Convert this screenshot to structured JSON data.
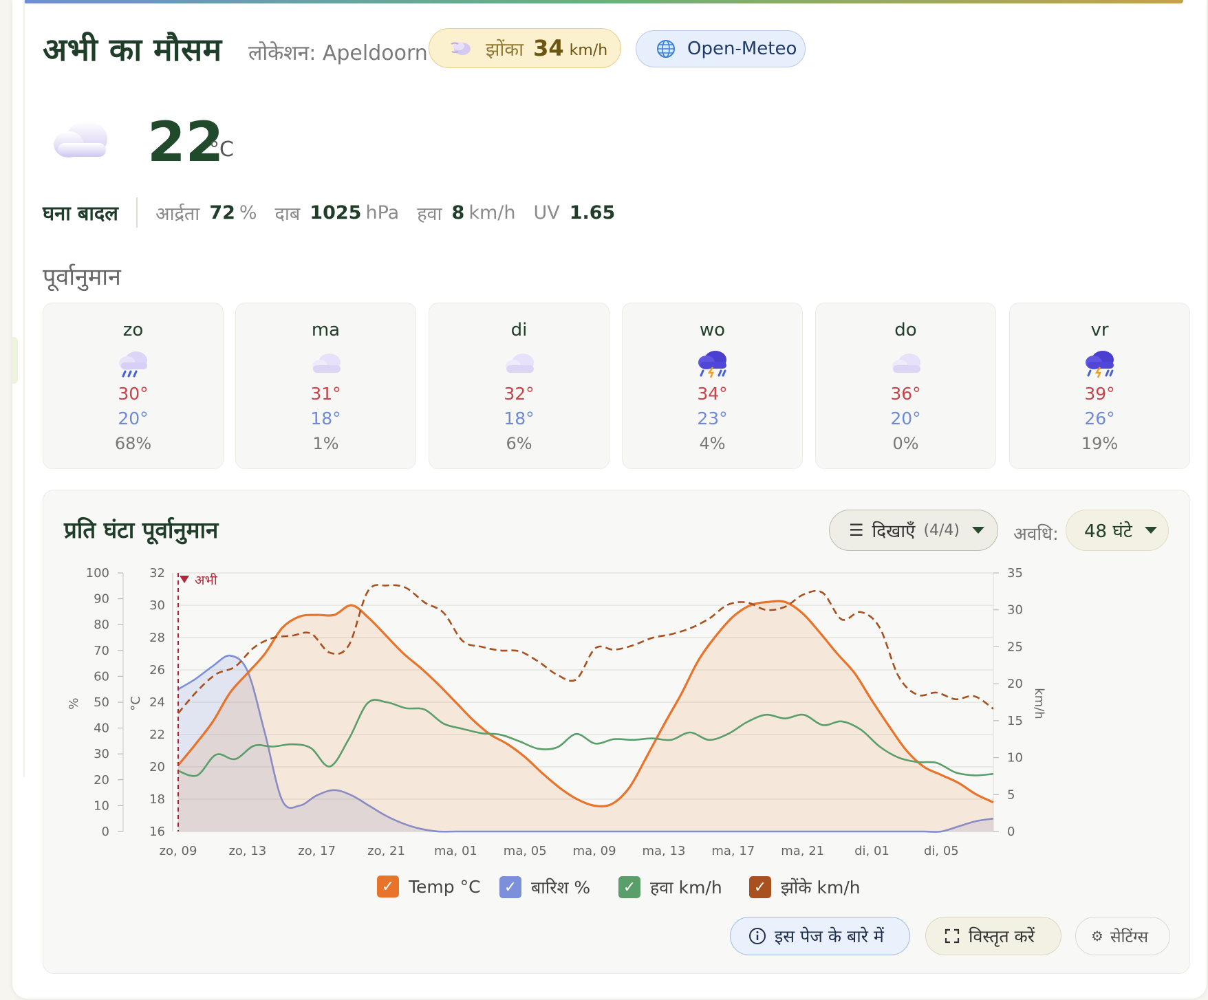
{
  "header": {
    "title": "अभी का मौसम",
    "location": "लोकेशन: Apeldoorn",
    "gust_label": "झोंका",
    "gust_value": "34",
    "gust_unit": "km/h",
    "source": "Open-Meteo"
  },
  "current": {
    "icon": "cloud-icon",
    "temperature": "22",
    "unit": "°C",
    "condition": "घना बादल",
    "humidity_label": "आर्द्रता",
    "humidity_value": "72",
    "humidity_unit": "%",
    "pressure_label": "दाब",
    "pressure_value": "1025",
    "pressure_unit": "hPa",
    "wind_label": "हवा",
    "wind_value": "8",
    "wind_unit": "km/h",
    "uv_label": "UV",
    "uv_value": "1.65"
  },
  "forecast": {
    "title": "पूर्वानुमान",
    "days": [
      {
        "day": "zo",
        "icon": "rain-cloud-icon",
        "high": "30°",
        "low": "20°",
        "precip": "68%"
      },
      {
        "day": "ma",
        "icon": "cloud-icon",
        "high": "31°",
        "low": "18°",
        "precip": "1%"
      },
      {
        "day": "di",
        "icon": "cloud-icon",
        "high": "32°",
        "low": "18°",
        "precip": "6%"
      },
      {
        "day": "wo",
        "icon": "thunderstorm-icon",
        "high": "34°",
        "low": "23°",
        "precip": "4%"
      },
      {
        "day": "do",
        "icon": "cloud-icon",
        "high": "36°",
        "low": "20°",
        "precip": "0%"
      },
      {
        "day": "vr",
        "icon": "thunderstorm-icon",
        "high": "39°",
        "low": "26°",
        "precip": "19%"
      }
    ]
  },
  "hourly": {
    "title": "प्रति घंटा पूर्वानुमान",
    "show_label": "दिखाएँ",
    "show_count": "(4/4)",
    "period_label": "अवधि:",
    "period_value": "48 घंटे",
    "now_label": "अभी",
    "legend": [
      {
        "label": "Temp °C",
        "color": "#e8732a"
      },
      {
        "label": "बारिश %",
        "color": "#7b8fdb"
      },
      {
        "label": "हवा km/h",
        "color": "#5a9e6a"
      },
      {
        "label": "झोंके km/h",
        "color": "#a8501e"
      }
    ],
    "about_button": "इस पेज के बारे में",
    "expand_button": "विस्तृत करें",
    "settings_button": "सेटिंग्स"
  },
  "chart_data": {
    "type": "line",
    "x_tick_labels": [
      "zo, 09",
      "zo, 13",
      "zo, 17",
      "zo, 21",
      "ma, 01",
      "ma, 05",
      "ma, 09",
      "ma, 13",
      "ma, 17",
      "ma, 21",
      "di, 01",
      "di, 05"
    ],
    "x_hours": [
      0,
      1,
      2,
      3,
      4,
      5,
      6,
      7,
      8,
      9,
      10,
      11,
      12,
      13,
      14,
      15,
      16,
      17,
      18,
      19,
      20,
      21,
      22,
      23,
      24,
      25,
      26,
      27,
      28,
      29,
      30,
      31,
      32,
      33,
      34,
      35,
      36,
      37,
      38,
      39,
      40,
      41,
      42,
      43,
      44,
      45,
      46,
      47
    ],
    "y_left_pct_label": "%",
    "y_left_pct_ticks": [
      0,
      10,
      20,
      30,
      40,
      50,
      60,
      70,
      80,
      90,
      100
    ],
    "y_left_pct_range": [
      0,
      100
    ],
    "y_left_temp_label": "°C",
    "y_left_temp_ticks": [
      16,
      18,
      20,
      22,
      24,
      26,
      28,
      30,
      32
    ],
    "y_left_temp_range": [
      16,
      32
    ],
    "y_right_label": "km/h",
    "y_right_ticks": [
      0,
      5,
      10,
      15,
      20,
      25,
      30,
      35
    ],
    "y_right_range": [
      0,
      35
    ],
    "grid": true,
    "series": [
      {
        "name": "Temp °C",
        "axis": "temp",
        "color": "#e8732a",
        "values": [
          20.1,
          21.4,
          22.8,
          24.6,
          25.8,
          27.0,
          28.6,
          29.3,
          29.4,
          29.4,
          30.0,
          29.2,
          28.1,
          27.0,
          26.1,
          25.1,
          24.0,
          22.9,
          22.0,
          21.4,
          20.6,
          19.6,
          18.7,
          18.0,
          17.6,
          17.7,
          18.7,
          20.6,
          22.6,
          24.5,
          26.6,
          28.1,
          29.3,
          30.0,
          30.2,
          30.2,
          29.5,
          28.3,
          27.0,
          25.8,
          24.1,
          22.5,
          21.0,
          20.0,
          19.5,
          19.0,
          18.3,
          17.8
        ]
      },
      {
        "name": "बारिश %",
        "axis": "pct",
        "color": "#7b8fdb",
        "values": [
          55,
          59,
          64,
          68,
          62,
          38,
          12,
          10,
          14,
          16,
          14,
          10,
          6,
          3,
          1,
          0,
          0,
          0,
          0,
          0,
          0,
          0,
          0,
          0,
          0,
          0,
          0,
          0,
          0,
          0,
          0,
          0,
          0,
          0,
          0,
          0,
          0,
          0,
          0,
          0,
          0,
          0,
          0,
          0,
          0,
          2,
          4,
          5
        ]
      },
      {
        "name": "हवा km/h",
        "axis": "wind",
        "color": "#5a9e6a",
        "values": [
          8.2,
          7.6,
          10.4,
          9.8,
          11.6,
          11.5,
          11.8,
          11.3,
          8.8,
          12.5,
          17.4,
          17.5,
          16.7,
          16.5,
          14.6,
          13.9,
          13.3,
          13.1,
          12.2,
          11.2,
          11.4,
          13.2,
          11.9,
          12.5,
          12.4,
          12.6,
          12.4,
          13.4,
          12.4,
          13.2,
          14.8,
          15.8,
          15.3,
          15.8,
          14.4,
          14.9,
          13.8,
          11.5,
          10.0,
          9.4,
          9.3,
          8.0,
          7.6,
          7.8
        ]
      },
      {
        "name": "झोंके km/h",
        "axis": "wind",
        "color": "#a8501e",
        "dashed": true,
        "values": [
          16.0,
          19.0,
          21.3,
          22.3,
          24.9,
          26.2,
          26.5,
          26.8,
          24.2,
          25.2,
          32.5,
          33.3,
          33.0,
          31.0,
          29.6,
          25.8,
          25.0,
          24.5,
          24.4,
          23.0,
          21.2,
          20.6,
          24.8,
          24.6,
          25.2,
          26.2,
          26.7,
          27.5,
          28.8,
          30.7,
          31.0,
          30.0,
          30.4,
          32.1,
          32.3,
          28.7,
          29.7,
          27.6,
          21.0,
          18.5,
          18.8,
          17.9,
          18.3,
          16.6
        ]
      }
    ]
  }
}
